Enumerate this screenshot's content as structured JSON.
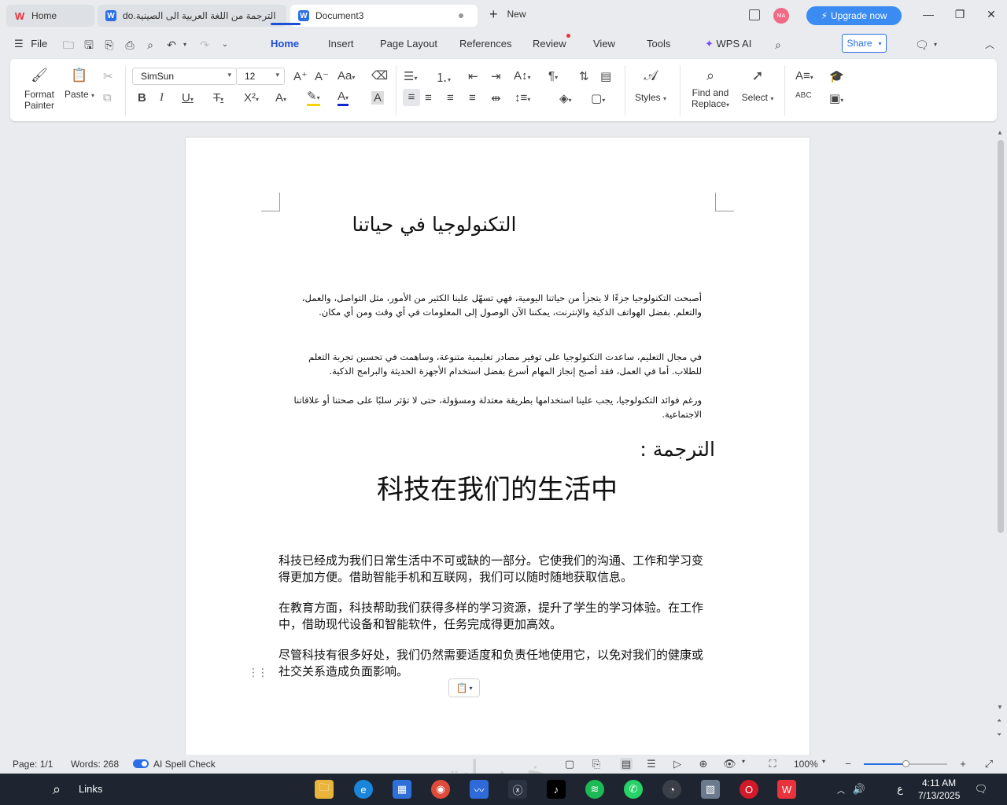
{
  "tabs": [
    {
      "label": "Home",
      "icon": "wps-home-icon"
    },
    {
      "label": "الترجمة من اللغة العربية الى الصينية.do",
      "icon": "writer-doc-icon"
    },
    {
      "label": "Document3",
      "icon": "writer-doc-icon"
    }
  ],
  "new_tab_label": "New",
  "avatar_initials": "MA",
  "upgrade_label": "Upgrade now",
  "menu": {
    "file": "File",
    "items": [
      "Home",
      "Insert",
      "Page Layout",
      "References",
      "Review",
      "View",
      "Tools"
    ],
    "wps_ai": "WPS AI",
    "share": "Share"
  },
  "ribbon": {
    "format_painter": [
      "Format",
      "Painter"
    ],
    "paste": "Paste",
    "font_name": "SimSun",
    "font_size": "12",
    "styles": "Styles",
    "find_replace": [
      "Find and",
      "Replace"
    ],
    "select": "Select"
  },
  "document": {
    "arabic_title": "التكنولوجيا في حياتنا",
    "arabic_paragraphs": [
      "أصبحت التكنولوجيا جزءًا لا يتجزأ من حياتنا اليومية، فهي تسهّل علينا الكثير من الأمور، مثل التواصل، والعمل، والتعلم. بفضل الهواتف الذكية والإنترنت، يمكننا الآن الوصول إلى المعلومات في أي وقت ومن أي مكان.",
      "في مجال التعليم، ساعدت التكنولوجيا على توفير مصادر تعليمية متنوعة، وساهمت في تحسين تجربة التعلم للطلاب. أما في العمل، فقد أصبح إنجاز المهام أسرع بفضل استخدام الأجهزة الحديثة والبرامج الذكية.",
      "ورغم فوائد التكنولوجيا، يجب علينا استخدامها بطريقة معتدلة ومسؤولة، حتى لا تؤثر سلبًا على صحتنا أو علاقاتنا الاجتماعية."
    ],
    "translation_heading": "الترجمة :",
    "chinese_title": "科技在我们的生活中",
    "chinese_paragraphs": [
      "科技已经成为我们日常生活中不可或缺的一部分。它使我们的沟通、工作和学习变得更加方便。借助智能手机和互联网，我们可以随时随地获取信息。",
      "在教育方面，科技帮助我们获得多样的学习资源，提升了学生的学习体验。在工作中，借助现代设备和智能软件，任务完成得更加高效。",
      "尽管科技有很多好处，我们仍然需要适度和负责任地使用它，以免对我们的健康或社交关系造成负面影响。"
    ]
  },
  "status": {
    "page": "Page: 1/1",
    "words": "Words: 268",
    "spell_check": "AI Spell Check",
    "zoom": "100%",
    "zoom_fraction": 0.5
  },
  "taskbar": {
    "search_label": "Links",
    "time": "4:11 AM",
    "date": "7/13/2025",
    "input_lang": "ع",
    "watermark": "خمسات"
  },
  "colors": {
    "accent": "#1f4fd6",
    "upgrade": "#3a8bf2",
    "wps_red": "#e8323c"
  }
}
